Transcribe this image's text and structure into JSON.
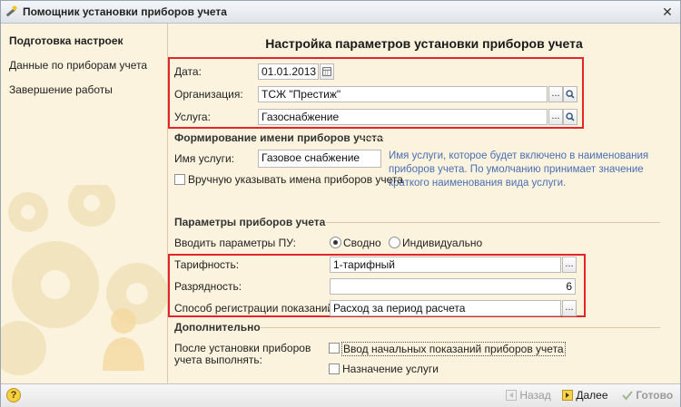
{
  "window": {
    "title": "Помощник установки приборов учета",
    "close_glyph": "✕"
  },
  "sidebar": {
    "items": [
      {
        "label": "Подготовка настроек",
        "active": true
      },
      {
        "label": "Данные по приборам учета",
        "active": false
      },
      {
        "label": "Завершение работы",
        "active": false
      }
    ]
  },
  "main": {
    "heading": "Настройка параметров установки приборов учета",
    "date_label": "Дата:",
    "date_value": "01.01.2013",
    "org_label": "Организация:",
    "org_value": "ТСЖ \"Престиж\"",
    "service_label": "Услуга:",
    "service_value": "Газоснабжение",
    "naming_section": "Формирование имени приборов учета",
    "service_name_label": "Имя услуги:",
    "service_name_value": "Газовое снабжение",
    "hint": "Имя услуги, которое будет включено в наименования приборов учета. По умолчанию принимает значение краткого наименования вида услуги.",
    "manual_names_label": "Вручную указывать имена приборов учета",
    "params_section": "Параметры приборов учета",
    "input_mode_label": "Вводить параметры ПУ:",
    "mode_summary": "Сводно",
    "mode_individual": "Индивидуально",
    "mode_selected": "Сводно",
    "tariff_label": "Тарифность:",
    "tariff_value": "1-тарифный",
    "digits_label": "Разрядность:",
    "digits_value": "6",
    "reg_method_label": "Способ регистрации показаний:",
    "reg_method_value": "Расход за период расчета",
    "extra_section": "Дополнительно",
    "after_label_1": "После установки приборов",
    "after_label_2": "учета выполнять:",
    "initial_readings_label": "Ввод начальных показаний приборов учета",
    "assign_service_label": "Назначение услуги",
    "ellipsis": "...",
    "help_glyph": "?"
  },
  "footer": {
    "back": "Назад",
    "next": "Далее",
    "finish": "Готово"
  },
  "colors": {
    "highlight": "#e3242b",
    "hint": "#4a6fb5",
    "background": "#fbf3de"
  },
  "icons": [
    "app-wand-icon",
    "close-icon",
    "calendar-icon",
    "search-icon",
    "ellipsis-icon",
    "help-icon",
    "back-arrow-icon",
    "next-arrow-icon",
    "checkmark-icon",
    "gears-decoration-icon"
  ]
}
